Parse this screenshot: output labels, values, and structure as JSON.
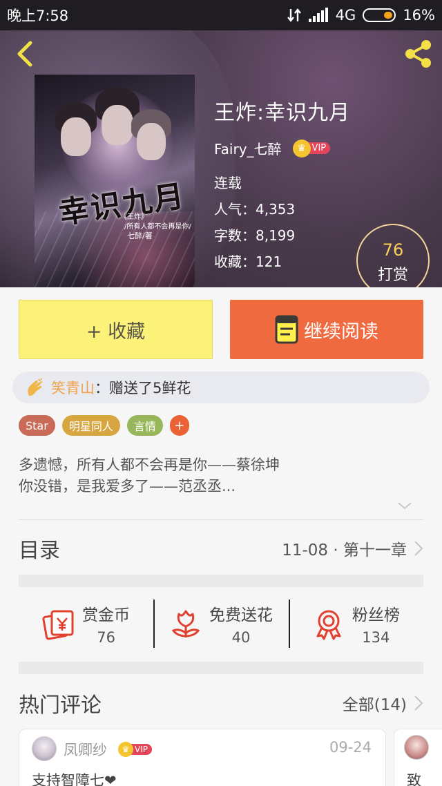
{
  "status_bar": {
    "time": "晚上7:58",
    "network": "4G",
    "battery": "16%"
  },
  "book": {
    "title": "王炸:幸识九月",
    "author": "Fairy_七醉",
    "vip_label": "VIP",
    "state": "连载",
    "popularity": "人气：4,353",
    "word_count": "字数：8,199",
    "favorites": "收藏：121",
    "cover": {
      "title": "幸识九月",
      "subtitle": "《王炸》",
      "blurb": "/所有人都不会再是你/",
      "author": "七醉/著"
    }
  },
  "reward": {
    "count": "76",
    "label": "打赏"
  },
  "actions": {
    "collect": "+ 收藏",
    "continue_read": "继续阅读"
  },
  "gift_notice": {
    "user": "笑青山",
    "text": "：赠送了5鲜花"
  },
  "tags": [
    "Star",
    "明星同人",
    "言情"
  ],
  "tag_add": "+",
  "description": {
    "line1": "多遗憾，所有人都不会再是你——蔡徐坤",
    "line2": "你没错，是我爱多了——范丞丞..."
  },
  "catalog": {
    "title": "目录",
    "latest": "11-08 · 第十一章"
  },
  "stats": [
    {
      "label": "赏金币",
      "value": "76",
      "icon": "red-envelope-icon"
    },
    {
      "label": "免费送花",
      "value": "40",
      "icon": "flower-icon"
    },
    {
      "label": "粉丝榜",
      "value": "134",
      "icon": "medal-icon"
    }
  ],
  "comments": {
    "title": "热门评论",
    "all": "全部(14)",
    "items": [
      {
        "user": "凤卿纱",
        "vip": "VIP",
        "date": "09-24",
        "text": "支持智障七❤"
      },
      {
        "text": "致"
      }
    ]
  },
  "colors": {
    "collect_bg": "#fdf279",
    "read_bg": "#ef6a3e",
    "gift_user": "#eea24a",
    "reward_num": "#f6cf5b"
  }
}
